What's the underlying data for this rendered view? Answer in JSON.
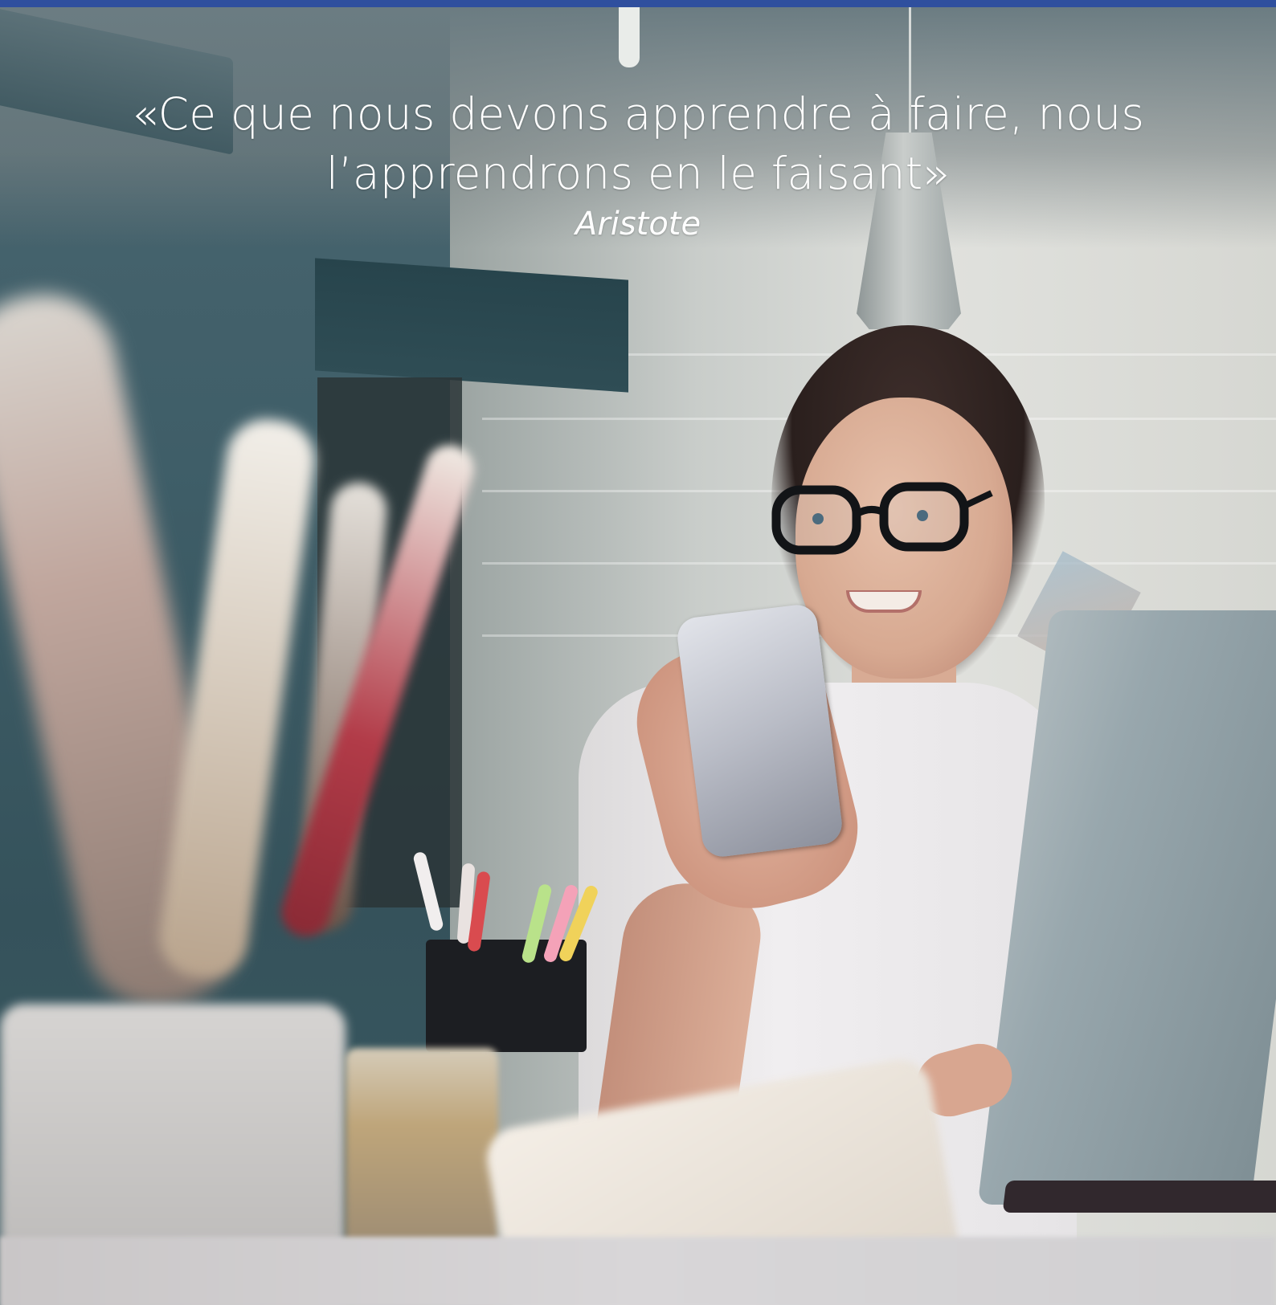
{
  "quote": {
    "line1": "«Ce que nous devons apprendre à faire, nous",
    "line2": "l’apprendrons en le faisant»",
    "author": "Aristote"
  },
  "colors": {
    "top_bar": "#2f4f9e",
    "quote_text": "#ffffff"
  },
  "photo": {
    "subject": "woman-with-glasses-using-smartphone-at-desk"
  }
}
